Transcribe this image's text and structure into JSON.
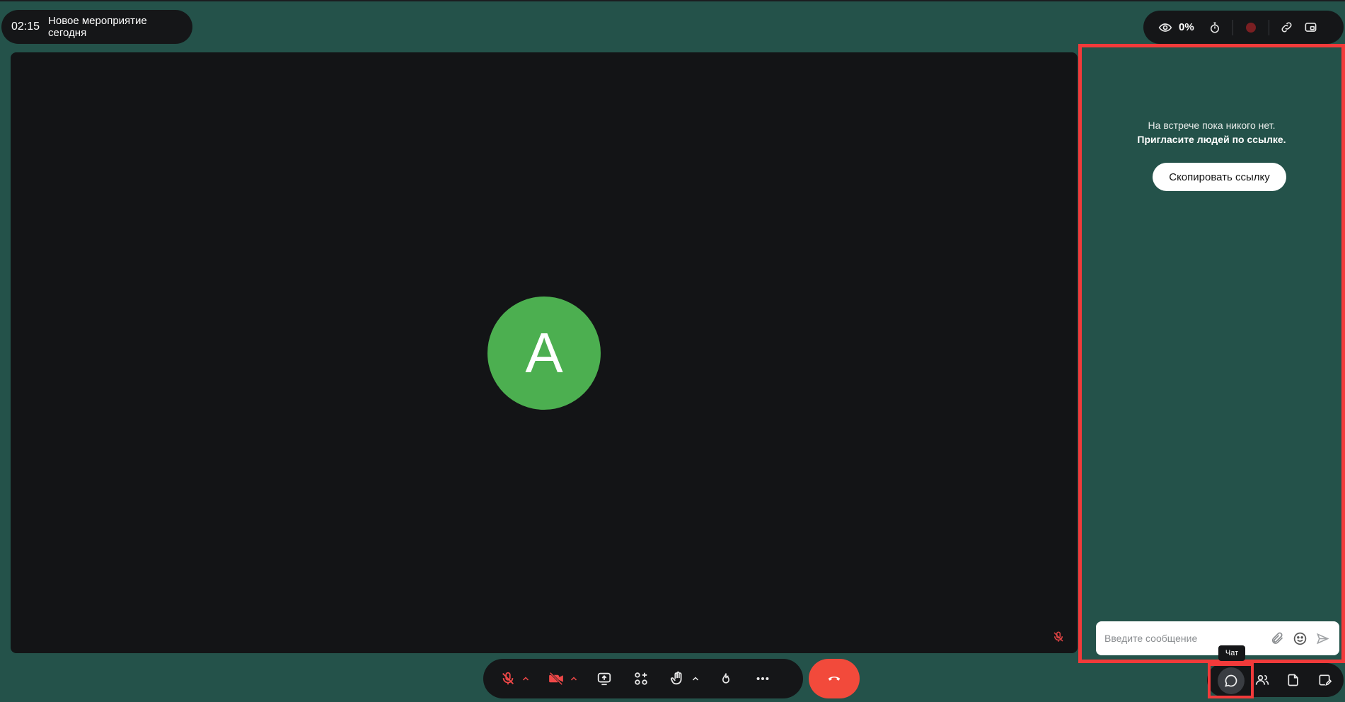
{
  "meeting": {
    "timer": "02:15",
    "title": "Новое мероприятие сегодня"
  },
  "top_tools": {
    "viewers_percent": "0%",
    "icons": [
      "eye-icon",
      "stopwatch-icon",
      "record-icon",
      "link-icon",
      "picture-in-picture-icon"
    ]
  },
  "stage": {
    "avatar_initial": "A",
    "avatar_color": "#4caf50"
  },
  "side_panel": {
    "empty_line1": "На встрече пока никого нет.",
    "empty_line2": "Пригласите людей по ссылке.",
    "copy_link_label": "Скопировать ссылку",
    "message_placeholder": "Введите сообщение"
  },
  "controls": {
    "icons": [
      "microphone-off-icon",
      "camera-off-icon",
      "screen-share-icon",
      "apps-icon",
      "raise-hand-icon",
      "reaction-icon",
      "more-icon",
      "hang-up-icon"
    ]
  },
  "panel_toggles": {
    "chat_tooltip": "Чат",
    "icons": [
      "chat-icon",
      "participants-icon",
      "files-icon",
      "notes-icon"
    ]
  },
  "colors": {
    "background": "#24524a",
    "hangup": "#f24a3b",
    "highlight": "#f23a3a"
  }
}
